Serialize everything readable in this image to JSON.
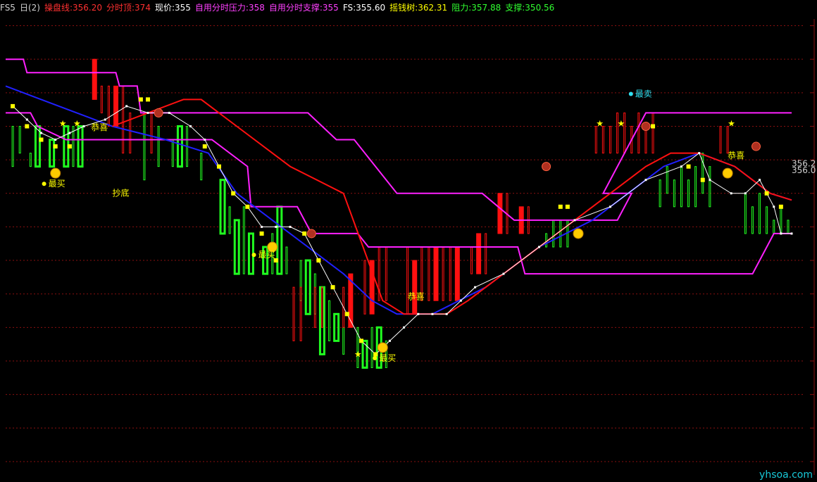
{
  "header": {
    "items": [
      {
        "text": "FS5",
        "color": "#d0d0d0"
      },
      {
        "text": "日(2)",
        "color": "#d0d0d0"
      },
      {
        "text": "操盘线:356.20",
        "color": "#ff3030"
      },
      {
        "text": "分时顶:374",
        "color": "#ff3030"
      },
      {
        "text": "现价:355",
        "color": "#ffffff"
      },
      {
        "text": "自用分时压力:358",
        "color": "#ff40ff"
      },
      {
        "text": "自用分时支撑:355",
        "color": "#ff40ff"
      },
      {
        "text": "FS:355.60",
        "color": "#ffffff"
      },
      {
        "text": "摇钱树:362.31",
        "color": "#ffff00"
      },
      {
        "text": "阻力:357.88",
        "color": "#30ff30"
      },
      {
        "text": "支撑:350.56",
        "color": "#30ff30"
      }
    ]
  },
  "watermark": "yhsoa.com",
  "colors": {
    "grid": "#8a1010",
    "pink": "#ff20ff",
    "blue": "#2020ff",
    "red": "#ff1010",
    "green": "#20ff20",
    "yellow": "#ffff00",
    "white": "#ffffff",
    "cyan": "#30e0f0"
  },
  "chart_data": {
    "type": "line",
    "ylim": [
      343,
      377
    ],
    "x_count": 222,
    "series": [
      {
        "key": "pink_top",
        "color": "#ff20ff",
        "points": [
          [
            0,
            374
          ],
          [
            5,
            374
          ],
          [
            6,
            373
          ],
          [
            31,
            373
          ],
          [
            32,
            372
          ],
          [
            37,
            372
          ],
          [
            38,
            370
          ],
          [
            85,
            370
          ],
          [
            93,
            368
          ],
          [
            98,
            368
          ],
          [
            110,
            364
          ],
          [
            134,
            364
          ],
          [
            143,
            362
          ],
          [
            172,
            362
          ],
          [
            176,
            364
          ],
          [
            168,
            364
          ],
          [
            180,
            370
          ],
          [
            219,
            370
          ],
          [
            221,
            370
          ]
        ]
      },
      {
        "key": "pink_bottom",
        "color": "#ff20ff",
        "points": [
          [
            0,
            370
          ],
          [
            7,
            370
          ],
          [
            9,
            369
          ],
          [
            17,
            368
          ],
          [
            58,
            368
          ],
          [
            68,
            366
          ],
          [
            69,
            363
          ],
          [
            82,
            363
          ],
          [
            86,
            361
          ],
          [
            99,
            361
          ],
          [
            102,
            360
          ],
          [
            144,
            360
          ],
          [
            146,
            358
          ],
          [
            210,
            358
          ],
          [
            216,
            361
          ],
          [
            221,
            361
          ]
        ]
      },
      {
        "key": "blue_ma",
        "color": "#2020ff",
        "points": [
          [
            0,
            372
          ],
          [
            10,
            371
          ],
          [
            20,
            370
          ],
          [
            30,
            369
          ],
          [
            45,
            368
          ],
          [
            57,
            367
          ],
          [
            65,
            364
          ],
          [
            75,
            362
          ],
          [
            85,
            360
          ],
          [
            95,
            358
          ],
          [
            103,
            356
          ],
          [
            110,
            355
          ],
          [
            120,
            355
          ],
          [
            135,
            357
          ],
          [
            150,
            360
          ],
          [
            165,
            362
          ],
          [
            175,
            364
          ],
          [
            185,
            366
          ],
          [
            195,
            367
          ],
          [
            205,
            366
          ],
          [
            215,
            364
          ],
          [
            221,
            363.5
          ]
        ]
      },
      {
        "key": "red_ma",
        "color": "#ff1010",
        "points": [
          [
            30,
            369
          ],
          [
            40,
            370
          ],
          [
            50,
            371
          ],
          [
            55,
            371
          ],
          [
            65,
            369
          ],
          [
            80,
            366
          ],
          [
            95,
            364
          ],
          [
            106,
            356
          ],
          [
            112,
            355
          ],
          [
            124,
            355
          ],
          [
            130,
            356
          ],
          [
            140,
            358
          ],
          [
            150,
            360
          ],
          [
            160,
            362
          ],
          [
            170,
            364
          ],
          [
            180,
            366
          ],
          [
            187,
            367
          ],
          [
            195,
            367
          ],
          [
            205,
            366
          ],
          [
            215,
            364
          ],
          [
            221,
            363.5
          ]
        ]
      },
      {
        "key": "white_price",
        "color": "#ffffff",
        "points": [
          [
            2,
            370.5
          ],
          [
            6,
            369.5
          ],
          [
            10,
            368.5
          ],
          [
            14,
            368
          ],
          [
            18,
            368.5
          ],
          [
            22,
            369
          ],
          [
            28,
            369.5
          ],
          [
            34,
            370.5
          ],
          [
            40,
            370
          ],
          [
            46,
            370
          ],
          [
            52,
            369
          ],
          [
            56,
            368
          ],
          [
            60,
            366
          ],
          [
            64,
            364
          ],
          [
            68,
            363
          ],
          [
            72,
            361.5
          ],
          [
            76,
            361.5
          ],
          [
            80,
            361.5
          ],
          [
            84,
            361
          ],
          [
            88,
            359
          ],
          [
            92,
            357
          ],
          [
            96,
            355
          ],
          [
            100,
            353
          ],
          [
            104,
            352
          ],
          [
            108,
            353
          ],
          [
            112,
            354
          ],
          [
            116,
            355
          ],
          [
            120,
            355
          ],
          [
            124,
            355
          ],
          [
            128,
            356
          ],
          [
            132,
            357
          ],
          [
            140,
            358
          ],
          [
            150,
            360
          ],
          [
            160,
            362
          ],
          [
            170,
            363
          ],
          [
            180,
            365
          ],
          [
            190,
            366
          ],
          [
            195,
            367
          ],
          [
            198,
            365
          ],
          [
            204,
            364
          ],
          [
            208,
            364
          ],
          [
            212,
            365
          ],
          [
            216,
            363
          ],
          [
            218,
            361
          ],
          [
            221,
            361
          ]
        ]
      }
    ],
    "red_bars": [
      [
        25,
        371,
        374
      ],
      [
        27,
        370,
        372
      ],
      [
        29,
        369,
        372
      ],
      [
        31,
        369,
        372
      ],
      [
        33,
        367,
        372
      ],
      [
        35,
        367,
        370
      ],
      [
        41,
        367,
        370
      ],
      [
        81,
        353,
        357
      ],
      [
        83,
        353,
        357
      ],
      [
        87,
        354,
        357
      ],
      [
        89,
        354,
        357
      ],
      [
        95,
        354,
        357
      ],
      [
        97,
        354,
        358
      ],
      [
        101,
        355,
        359
      ],
      [
        103,
        355,
        359
      ],
      [
        105,
        356,
        360
      ],
      [
        107,
        356,
        360
      ],
      [
        113,
        355,
        360
      ],
      [
        115,
        355,
        359
      ],
      [
        117,
        356,
        360
      ],
      [
        119,
        356,
        360
      ],
      [
        121,
        356,
        360
      ],
      [
        123,
        356,
        360
      ],
      [
        125,
        356,
        360
      ],
      [
        127,
        356,
        360
      ],
      [
        131,
        358,
        360
      ],
      [
        133,
        358,
        361
      ],
      [
        135,
        358,
        361
      ],
      [
        139,
        361,
        364
      ],
      [
        141,
        361,
        364
      ],
      [
        145,
        361,
        363
      ],
      [
        147,
        361,
        363
      ],
      [
        166,
        367,
        369
      ],
      [
        168,
        367,
        369
      ],
      [
        170,
        367,
        369
      ],
      [
        172,
        367,
        370
      ],
      [
        174,
        367,
        370
      ],
      [
        176,
        367,
        369
      ],
      [
        178,
        367,
        370
      ],
      [
        180,
        367,
        369
      ],
      [
        182,
        367,
        370
      ],
      [
        201,
        367,
        369
      ],
      [
        203,
        367,
        369
      ]
    ],
    "green_bars": [
      [
        2,
        366,
        369
      ],
      [
        4,
        367,
        369
      ],
      [
        7,
        366,
        367
      ],
      [
        9,
        366,
        369
      ],
      [
        13,
        366,
        368
      ],
      [
        17,
        366,
        369
      ],
      [
        19,
        366,
        369
      ],
      [
        21,
        366,
        369
      ],
      [
        39,
        365,
        370
      ],
      [
        43,
        366,
        369
      ],
      [
        47,
        366,
        368
      ],
      [
        49,
        366,
        369
      ],
      [
        51,
        366,
        369
      ],
      [
        55,
        365,
        367
      ],
      [
        61,
        361,
        365
      ],
      [
        63,
        361,
        363
      ],
      [
        65,
        358,
        362
      ],
      [
        67,
        358,
        363
      ],
      [
        69,
        358,
        361
      ],
      [
        73,
        358,
        360
      ],
      [
        75,
        358,
        361
      ],
      [
        77,
        358,
        363
      ],
      [
        79,
        358,
        360
      ],
      [
        83,
        356,
        359
      ],
      [
        85,
        355,
        359
      ],
      [
        87,
        355,
        358
      ],
      [
        89,
        352,
        357
      ],
      [
        91,
        353,
        356
      ],
      [
        93,
        353,
        355
      ],
      [
        95,
        352,
        354
      ],
      [
        99,
        351,
        354
      ],
      [
        101,
        351,
        353
      ],
      [
        103,
        351,
        354
      ],
      [
        105,
        351,
        354
      ],
      [
        107,
        351,
        353
      ],
      [
        152,
        360,
        361
      ],
      [
        154,
        360,
        362
      ],
      [
        156,
        360,
        362
      ],
      [
        158,
        360,
        362
      ],
      [
        184,
        363,
        365
      ],
      [
        186,
        364,
        366
      ],
      [
        188,
        363,
        365
      ],
      [
        190,
        363,
        366
      ],
      [
        192,
        363,
        365
      ],
      [
        194,
        363,
        366
      ],
      [
        196,
        364,
        367
      ],
      [
        198,
        363,
        366
      ],
      [
        208,
        361,
        364
      ],
      [
        210,
        361,
        363
      ],
      [
        212,
        361,
        364
      ],
      [
        214,
        361,
        363
      ],
      [
        216,
        361,
        362
      ],
      [
        218,
        361,
        363
      ],
      [
        220,
        361,
        362
      ]
    ],
    "yellow_squares": [
      [
        2,
        370.5
      ],
      [
        6,
        369
      ],
      [
        10,
        368
      ],
      [
        14,
        367.5
      ],
      [
        18,
        367.5
      ],
      [
        38,
        371
      ],
      [
        40,
        371
      ],
      [
        56,
        367.5
      ],
      [
        60,
        366
      ],
      [
        64,
        364
      ],
      [
        68,
        363
      ],
      [
        72,
        361
      ],
      [
        76,
        359
      ],
      [
        84,
        361
      ],
      [
        88,
        359
      ],
      [
        92,
        357
      ],
      [
        96,
        355
      ],
      [
        100,
        353
      ],
      [
        104,
        352
      ],
      [
        156,
        363
      ],
      [
        158,
        363
      ],
      [
        180,
        369
      ],
      [
        182,
        369
      ],
      [
        192,
        366
      ],
      [
        196,
        365
      ],
      [
        214,
        364
      ],
      [
        218,
        363
      ]
    ],
    "markers": [
      {
        "type": "face",
        "x": 14,
        "y": 365.5
      },
      {
        "type": "face",
        "x": 75,
        "y": 360
      },
      {
        "type": "face",
        "x": 106,
        "y": 352.5
      },
      {
        "type": "face",
        "x": 161,
        "y": 361
      },
      {
        "type": "face",
        "x": 203,
        "y": 365.5
      },
      {
        "type": "ball",
        "x": 43,
        "y": 370
      },
      {
        "type": "ball",
        "x": 86,
        "y": 361
      },
      {
        "type": "ball",
        "x": 152,
        "y": 366
      },
      {
        "type": "ball",
        "x": 180,
        "y": 369
      },
      {
        "type": "ball",
        "x": 211,
        "y": 367.5
      }
    ],
    "labels": [
      {
        "text": "最买",
        "x": 12,
        "y": 364.5,
        "color": "#ffff00",
        "dot": true
      },
      {
        "text": "抄底",
        "x": 30,
        "y": 363.8,
        "color": "#ffff00",
        "dot": false
      },
      {
        "text": "恭喜",
        "x": 24,
        "y": 368.7,
        "color": "#ffff00",
        "dot": false
      },
      {
        "text": "最买",
        "x": 71,
        "y": 359.2,
        "color": "#ffff00",
        "dot": true
      },
      {
        "text": "恭喜",
        "x": 113,
        "y": 356.1,
        "color": "#ffff00",
        "dot": false
      },
      {
        "text": "最买",
        "x": 105,
        "y": 351.5,
        "color": "#ffff00",
        "dot": true
      },
      {
        "text": "最卖",
        "x": 177,
        "y": 371.2,
        "color": "#30e0f0",
        "dot": true
      },
      {
        "text": "恭喜",
        "x": 203,
        "y": 366.6,
        "color": "#ffff00",
        "dot": false
      },
      {
        "text": "356.2",
        "x": 221,
        "y": 366,
        "color": "#d0d0d0",
        "dot": false
      },
      {
        "text": "356.0",
        "x": 221,
        "y": 365.5,
        "color": "#d0d0d0",
        "dot": false
      }
    ],
    "stars": [
      [
        15,
        369
      ],
      [
        19,
        369
      ],
      [
        98,
        351.8
      ],
      [
        166,
        369
      ],
      [
        172,
        369
      ],
      [
        203,
        369
      ]
    ]
  }
}
